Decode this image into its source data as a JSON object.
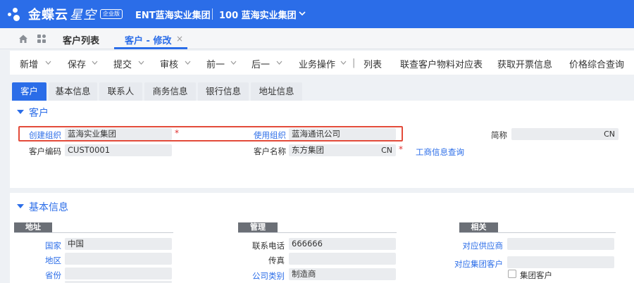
{
  "header": {
    "brand_main": "金蝶云",
    "brand_sub": "星空",
    "edition": "企业版",
    "org_title": "ENT蓝海实业集团",
    "org_name": "100 蓝海实业集团"
  },
  "tabs": {
    "list_label": "客户列表",
    "edit_label": "客户 - 修改",
    "close_glyph": "×"
  },
  "toolbar": {
    "items": [
      "新增",
      "保存",
      "提交",
      "审核",
      "前一",
      "后一",
      "业务操作",
      "列表",
      "联查客户物料对应表",
      "获取开票信息",
      "价格综合查询"
    ],
    "separator": "|"
  },
  "form_tabs": [
    "客户",
    "基本信息",
    "联系人",
    "商务信息",
    "银行信息",
    "地址信息"
  ],
  "section_customer": {
    "title": "客户",
    "create_org_label": "创建组织",
    "create_org_value": "蓝海实业集团",
    "use_org_label": "使用组织",
    "use_org_value": "蓝海通讯公司",
    "short_name_label": "简称",
    "short_name_suffix": "CN",
    "code_label": "客户编码",
    "code_value": "CUST0001",
    "name_label": "客户名称",
    "name_value": "东方集团",
    "name_suffix": "CN",
    "required_mark": "*",
    "biz_query_link": "工商信息查询"
  },
  "section_basic": {
    "title": "基本信息",
    "group_address": "地址",
    "group_manage": "管理",
    "group_related": "相关",
    "country_label": "国家",
    "country_value": "中国",
    "region_label": "地区",
    "province_label": "省份",
    "phone_label": "联系电话",
    "phone_value": "666666",
    "fax_label": "传真",
    "company_type_label": "公司类别",
    "company_type_value": "制造商",
    "supplier_label": "对应供应商",
    "group_customer_label": "对应集团客户",
    "group_customer_check_label": "集团客户"
  },
  "colors": {
    "primary": "#2b6de8",
    "highlight": "#e34b3a",
    "required": "#e03030"
  }
}
